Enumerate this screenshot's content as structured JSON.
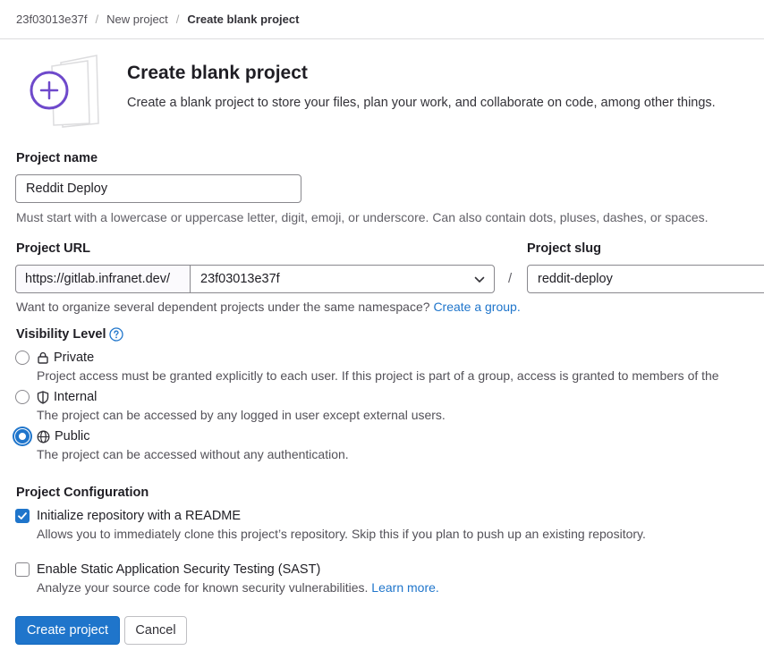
{
  "breadcrumb": {
    "items": [
      "23f03013e37f",
      "New project",
      "Create blank project"
    ]
  },
  "header": {
    "title": "Create blank project",
    "description": "Create a blank project to store your files, plan your work, and collaborate on code, among other things."
  },
  "form": {
    "project_name": {
      "label": "Project name",
      "value": "Reddit Deploy",
      "help": "Must start with a lowercase or uppercase letter, digit, emoji, or underscore. Can also contain dots, pluses, dashes, or spaces."
    },
    "project_url": {
      "label": "Project URL",
      "prefix": "https://gitlab.infranet.dev/",
      "namespace": "23f03013e37f",
      "separator": "/",
      "help_text": "Want to organize several dependent projects under the same namespace?",
      "help_link": "Create a group."
    },
    "project_slug": {
      "label": "Project slug",
      "value": "reddit-deploy"
    },
    "visibility": {
      "label": "Visibility Level",
      "selected": "Public",
      "options": [
        {
          "label": "Private",
          "icon": "lock-icon",
          "desc": "Project access must be granted explicitly to each user. If this project is part of a group, access is granted to members of the"
        },
        {
          "label": "Internal",
          "icon": "shield-icon",
          "desc": "The project can be accessed by any logged in user except external users."
        },
        {
          "label": "Public",
          "icon": "globe-icon",
          "desc": "The project can be accessed without any authentication."
        }
      ]
    },
    "configuration": {
      "label": "Project Configuration",
      "readme": {
        "label": "Initialize repository with a README",
        "checked": true,
        "desc": "Allows you to immediately clone this project’s repository. Skip this if you plan to push up an existing repository."
      },
      "sast": {
        "label": "Enable Static Application Security Testing (SAST)",
        "checked": false,
        "desc": "Analyze your source code for known security vulnerabilities.",
        "link": "Learn more."
      }
    }
  },
  "actions": {
    "create": "Create project",
    "cancel": "Cancel"
  },
  "colors": {
    "accent": "#1f75cb",
    "illustration": "#6e49cb"
  }
}
